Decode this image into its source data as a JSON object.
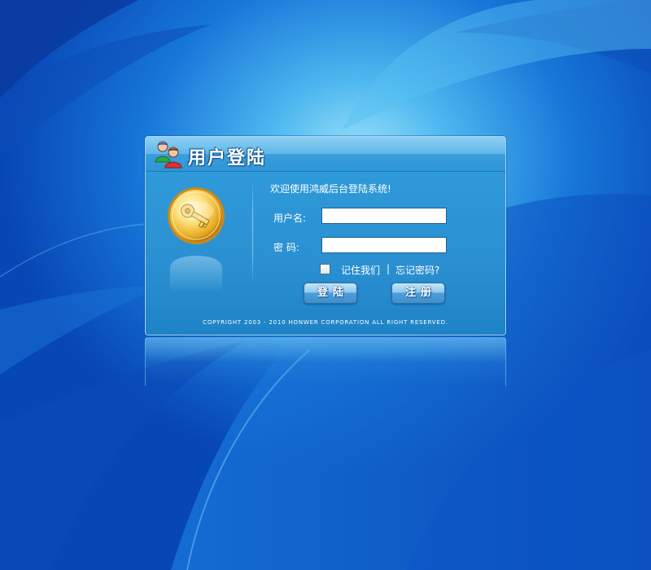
{
  "login_panel": {
    "title": "用户登陆",
    "welcome": "欢迎使用鸿威后台登陆系统!",
    "username_label": "用户名:",
    "username_value": "",
    "password_label": "密 码:",
    "password_value": "",
    "remember_label": "记住我们",
    "separator": "|",
    "forgot_link": "忘记密码?",
    "remember_checked": false,
    "login_button": "登陆",
    "register_button": "注册",
    "copyright": "COPYRIGHT 2003 - 2010 HONWER CORPORATION ALL RIGHT RESERVED."
  },
  "icons": {
    "header": "users-icon",
    "side": "key-icon"
  },
  "colors": {
    "background": "#0a58c8",
    "panel": "#2a92d3",
    "header_light": "#8fd0f3",
    "button": "#4f9fd8",
    "text": "#ffffff"
  }
}
